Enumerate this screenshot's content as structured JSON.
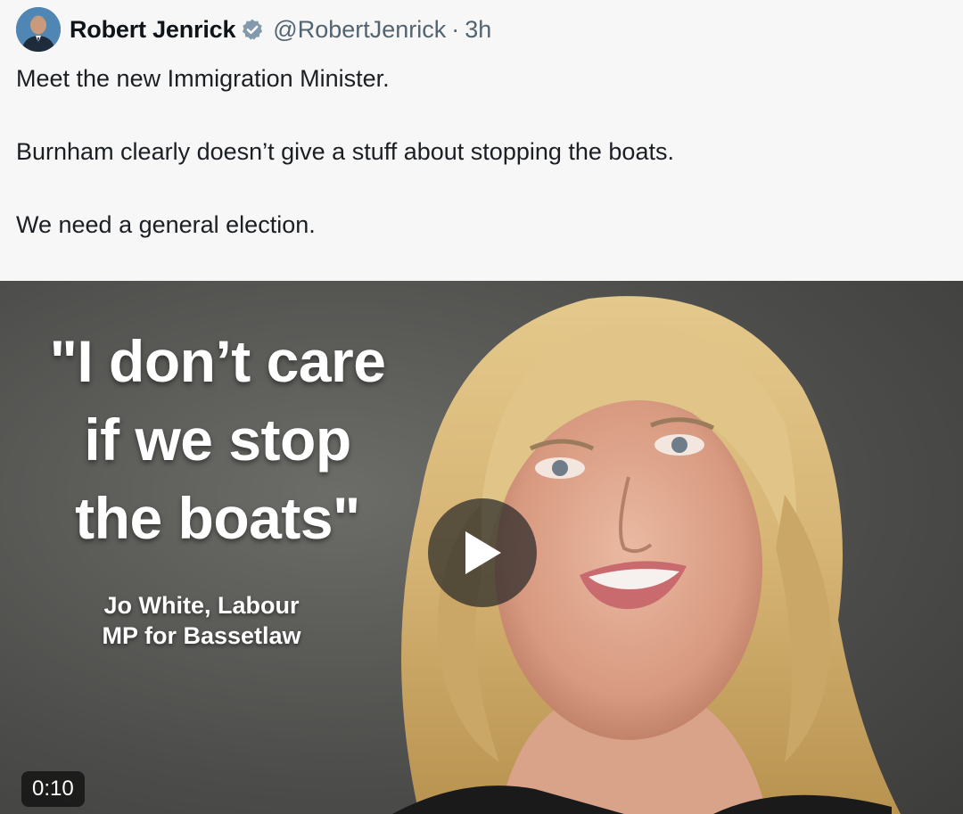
{
  "tweet": {
    "author_name": "Robert Jenrick",
    "verified_icon": "verified-badge-icon",
    "handle": "@RobertJenrick",
    "separator": "·",
    "time": "3h",
    "lines": [
      "Meet the new Immigration Minister.",
      "Burnham clearly doesn’t give a stuff about stopping the boats.",
      "We need a general election."
    ]
  },
  "video": {
    "quote_lines": [
      "\"I don’t care",
      "if we stop",
      "the boats\""
    ],
    "caption_lines": [
      "Jo White, Labour",
      "MP for Bassetlaw"
    ],
    "duration": "0:10",
    "play_icon": "play-icon"
  },
  "colors": {
    "verified": "#829aab",
    "handle": "#536471",
    "background": "#f7f7f7"
  }
}
